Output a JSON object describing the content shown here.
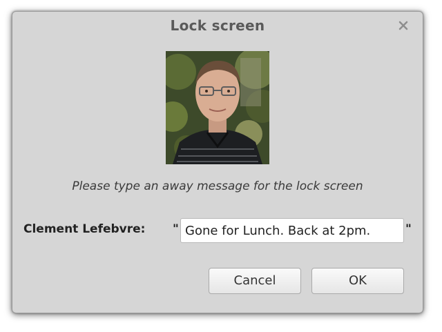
{
  "dialog": {
    "title": "Lock screen",
    "close_icon": "close-icon"
  },
  "avatar": {
    "icon": "user-avatar-photo"
  },
  "prompt": {
    "text": "Please type an away message for the lock screen"
  },
  "message": {
    "user_label": "Clement Lefebvre:",
    "quote_open": "\"",
    "quote_close": "\"",
    "value": "Gone for Lunch. Back at 2pm."
  },
  "buttons": {
    "cancel_label": "Cancel",
    "ok_label": "OK"
  },
  "colors": {
    "dialog_bg": "#d6d6d6",
    "title_text": "#5a5a5a",
    "input_bg": "#ffffff"
  }
}
